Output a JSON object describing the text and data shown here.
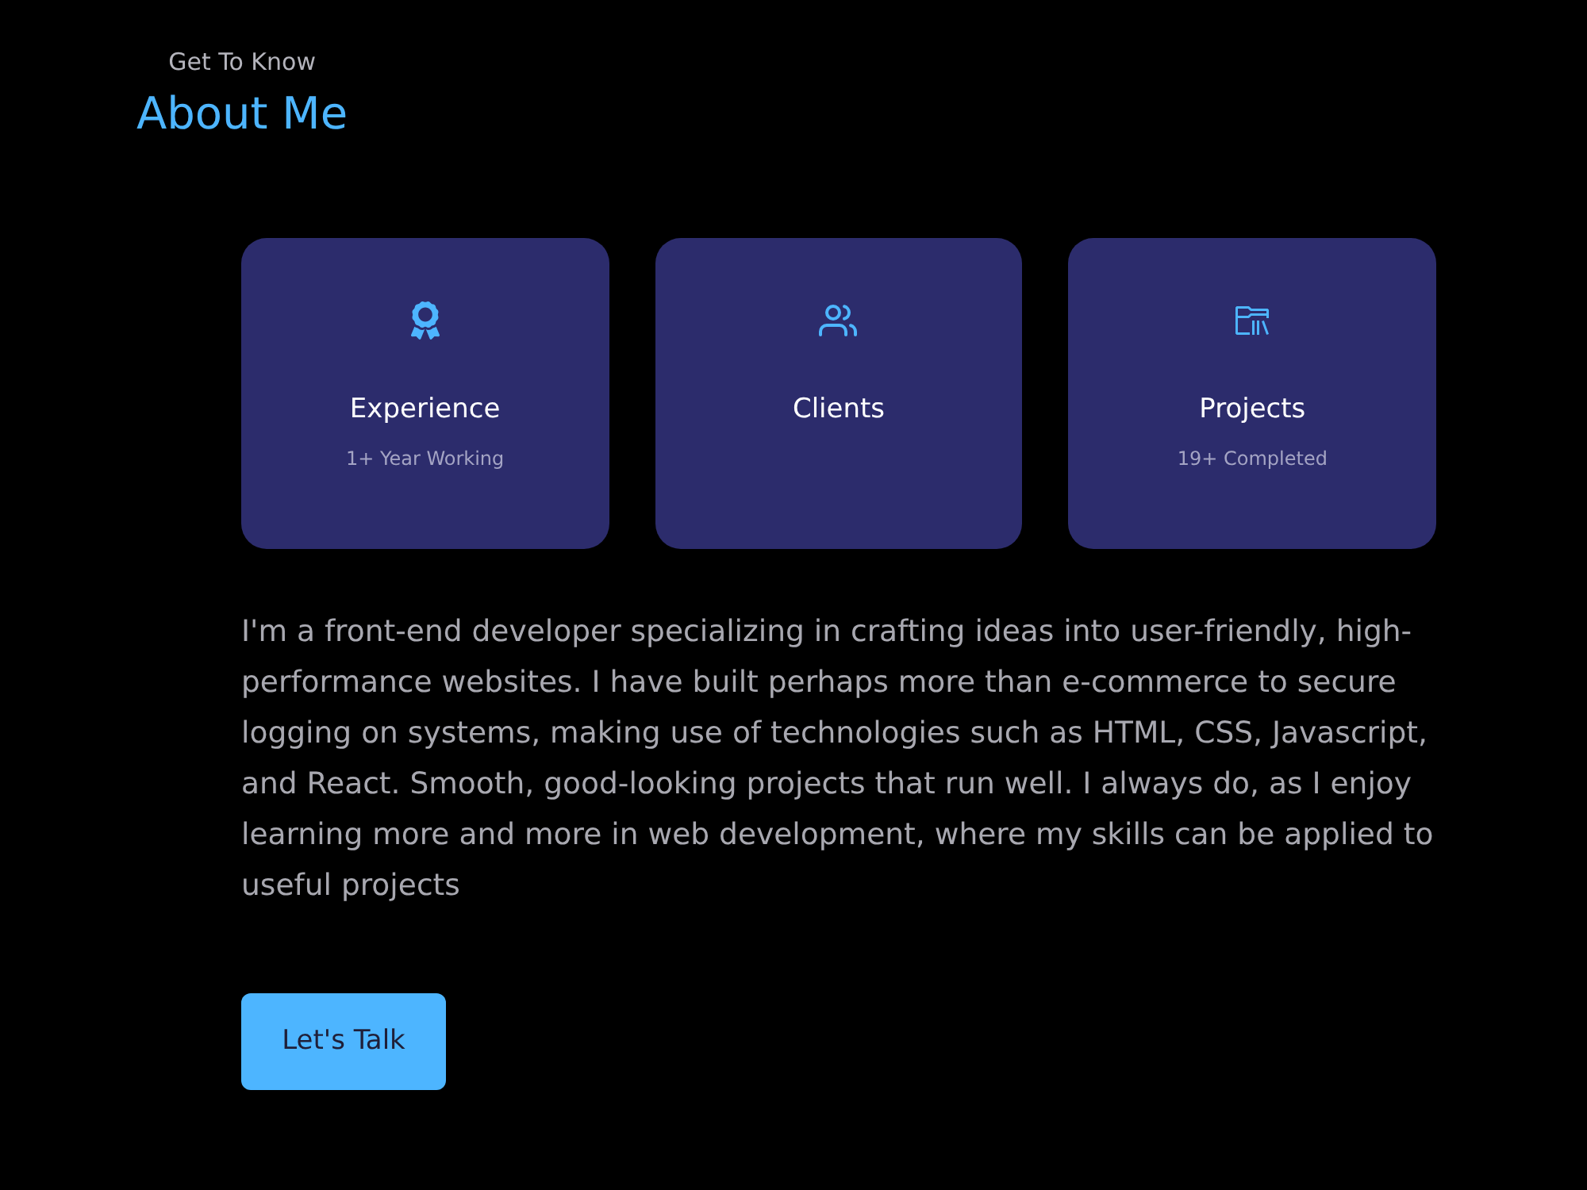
{
  "header": {
    "eyebrow": "Get To Know",
    "title": "About Me"
  },
  "cards": [
    {
      "title": "Experience",
      "subtitle": "1+ Year Working"
    },
    {
      "title": "Clients"
    },
    {
      "title": "Projects",
      "subtitle": "19+ Completed"
    }
  ],
  "description": "I'm a front-end developer specializing in crafting ideas into user-friendly, high-performance websites. I have built perhaps more than e-commerce to secure logging on systems, making use of technologies such as HTML, CSS, Javascript, and React. Smooth, good-looking projects that run well. I always do, as I enjoy learning more and more in web development, where my skills can be applied to useful projects",
  "button": {
    "label": "Let's Talk"
  }
}
